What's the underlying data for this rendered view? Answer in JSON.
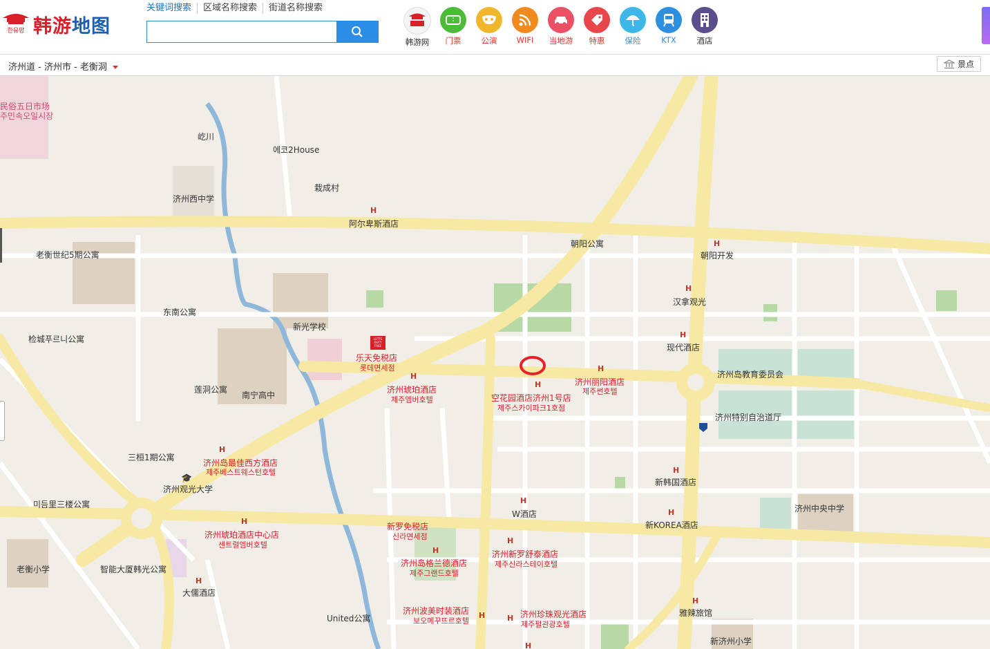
{
  "header": {
    "logo": {
      "korean": "한유망",
      "brand_red": "韩游",
      "brand_blue": "地图"
    },
    "search_tabs": [
      "关键词搜索",
      "区域名称搜索",
      "街道名称搜索"
    ],
    "search": {
      "placeholder": "",
      "value": ""
    },
    "nav": [
      {
        "label": "韩游网",
        "icon": "hanyou-icon"
      },
      {
        "label": "门票",
        "icon": "ticket-icon"
      },
      {
        "label": "公演",
        "icon": "mask-icon"
      },
      {
        "label": "WIFI",
        "icon": "wifi-icon"
      },
      {
        "label": "当地游",
        "icon": "car-icon"
      },
      {
        "label": "特惠",
        "icon": "sale-tag-icon"
      },
      {
        "label": "保险",
        "icon": "umbrella-icon"
      },
      {
        "label": "KTX",
        "icon": "train-icon"
      },
      {
        "label": "酒店",
        "icon": "building-icon"
      }
    ]
  },
  "breadcrumb": {
    "text": "济州道 - 济州市 - 老衡洞",
    "spot_button": "景点"
  },
  "map": {
    "labels": [
      {
        "t": "民俗五日市场",
        "kind": "pink"
      },
      {
        "t": "주민속오일시장",
        "kind": "pink"
      },
      {
        "t": "屹川",
        "kind": "dark"
      },
      {
        "t": "에코2House",
        "kind": "dark"
      },
      {
        "t": "栽成村",
        "kind": "dark"
      },
      {
        "t": "济州西中学",
        "kind": "dark"
      },
      {
        "t": "阿尔卑斯酒店",
        "kind": "dark"
      },
      {
        "t": "朝阳公寓",
        "kind": "dark"
      },
      {
        "t": "朝阳开发",
        "kind": "dark"
      },
      {
        "t": "老衡世纪5期公寓",
        "kind": "dark"
      },
      {
        "t": "汉拿观光",
        "kind": "dark"
      },
      {
        "t": "东南公寓",
        "kind": "dark"
      },
      {
        "t": "新光学校",
        "kind": "dark"
      },
      {
        "t": "检城푸르니公寓",
        "kind": "dark"
      },
      {
        "t": "现代酒店",
        "kind": "dark"
      },
      {
        "t": "乐天免税店",
        "kind": "red"
      },
      {
        "t": "롯데면세점",
        "kind": "red"
      },
      {
        "t": "济州岛教育委员会",
        "kind": "dark"
      },
      {
        "t": "济州丽阳酒店",
        "kind": "red"
      },
      {
        "t": "제주썬호텔",
        "kind": "red"
      },
      {
        "t": "济州琥珀酒店",
        "kind": "red"
      },
      {
        "t": "제주엠버호텔",
        "kind": "red"
      },
      {
        "t": "莲洞公寓",
        "kind": "dark"
      },
      {
        "t": "南宁高中",
        "kind": "dark"
      },
      {
        "t": "空花园酒店济州1号店",
        "kind": "red"
      },
      {
        "t": "제주스카이파크1호점",
        "kind": "red"
      },
      {
        "t": "济州特别自治道厅",
        "kind": "dark"
      },
      {
        "t": "三桓1期公寓",
        "kind": "dark"
      },
      {
        "t": "济州岛最佳西方酒店",
        "kind": "red"
      },
      {
        "t": "제주베스트웨스턴호텔",
        "kind": "red"
      },
      {
        "t": "新韩国酒店",
        "kind": "dark"
      },
      {
        "t": "济州观光大学",
        "kind": "dark"
      },
      {
        "t": "미듬里三楼公寓",
        "kind": "dark"
      },
      {
        "t": "W酒店",
        "kind": "dark"
      },
      {
        "t": "济州中央中学",
        "kind": "dark"
      },
      {
        "t": "新罗免税店",
        "kind": "red"
      },
      {
        "t": "신라면세점",
        "kind": "red"
      },
      {
        "t": "新KOREA酒店",
        "kind": "dark"
      },
      {
        "t": "济州琥珀酒店中心店",
        "kind": "red"
      },
      {
        "t": "센트럴엠버호텔",
        "kind": "red"
      },
      {
        "t": "济州新罗舒泰酒店",
        "kind": "red"
      },
      {
        "t": "제주신라스테이호텔",
        "kind": "red"
      },
      {
        "t": "老衡小学",
        "kind": "dark"
      },
      {
        "t": "智能大厦韩光公寓",
        "kind": "dark"
      },
      {
        "t": "济州岛格兰德酒店",
        "kind": "red"
      },
      {
        "t": "제주그랜드호텔",
        "kind": "red"
      },
      {
        "t": "大儒酒店",
        "kind": "dark"
      },
      {
        "t": "济州波美时装酒店",
        "kind": "red"
      },
      {
        "t": "보오메꾸뜨르호텔",
        "kind": "red"
      },
      {
        "t": "济州珍珠观光酒店",
        "kind": "red"
      },
      {
        "t": "제주펄관광호텔",
        "kind": "red"
      },
      {
        "t": "雅辣旅馆",
        "kind": "dark"
      },
      {
        "t": "United公寓",
        "kind": "dark"
      },
      {
        "t": "新济州小学",
        "kind": "dark"
      }
    ],
    "lotte_logo": [
      "LOTTE",
      "DUTY",
      "FREE"
    ]
  },
  "colors": {
    "accent": "#2b8ee6",
    "brand_red": "#d8202a",
    "road_main": "#f7e9a3",
    "road_minor": "#ffffff",
    "map_bg": "#f1eee8",
    "river": "#8fb7d9",
    "park": "#b7d9a6"
  }
}
